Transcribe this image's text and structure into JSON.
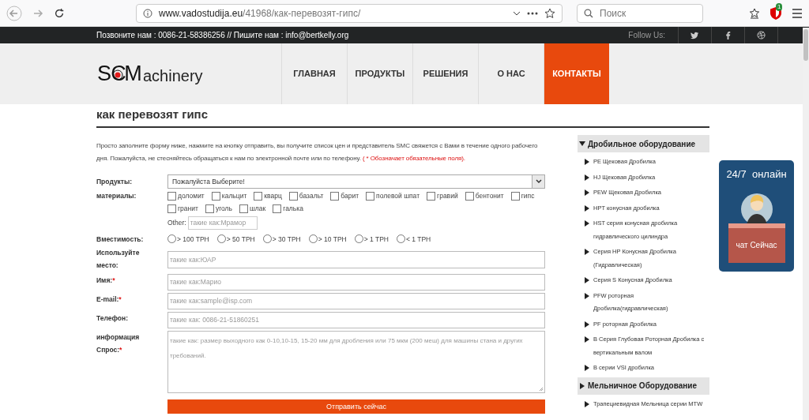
{
  "browser": {
    "url_host": "www.vadostudija.eu",
    "url_path": "/41968/как-перевозят-гипс/",
    "search_placeholder": "Поиск",
    "badge": "1"
  },
  "topbar": {
    "contact": "Позвоните нам : 0086-21-58386256 // Пишите нам : info@bertkelly.org",
    "follow": "Follow Us:"
  },
  "logo": {
    "left": "SC",
    "right": "M",
    "suffix": "achinery"
  },
  "nav": [
    {
      "label": "ГЛАВНАЯ",
      "selected": false
    },
    {
      "label": "ПРОДУКТЫ",
      "selected": false
    },
    {
      "label": "РЕШЕНИЯ",
      "selected": false
    },
    {
      "label": "О НАС",
      "selected": false
    },
    {
      "label": "КОНТАКТЫ",
      "selected": true
    }
  ],
  "page_title": "как перевозят гипс",
  "intro": "Просто заполните форму ниже, нажмите на кнопку отправить, вы получите список цен и представитель SMC свяжется с Вами в течение одного рабочего дня. Пожалуйста, не стесняйтесь обращаться к нам по электронной почте или по телефону.",
  "intro_required": "( * Обозначает обязательные поля).",
  "form": {
    "products_label": "Продукты:",
    "products_value": "Пожалуйста Выберите!",
    "materials_label": "материалы:",
    "materials": [
      {
        "label": "доломит",
        "checked": false
      },
      {
        "label": "кальцит",
        "checked": false
      },
      {
        "label": "кварц",
        "checked": false
      },
      {
        "label": "базальт",
        "checked": false
      },
      {
        "label": "барит",
        "checked": false
      },
      {
        "label": "полевой шпат",
        "checked": false
      },
      {
        "label": "гравий",
        "checked": false
      },
      {
        "label": "бентонит",
        "checked": false
      },
      {
        "label": "гипс",
        "checked": false
      },
      {
        "label": "гранит",
        "checked": false
      },
      {
        "label": "уголь",
        "checked": false
      },
      {
        "label": "шлак",
        "checked": false
      },
      {
        "label": "галька",
        "checked": false
      }
    ],
    "other_label": "Other:",
    "other_placeholder": "такие как:Мрамор",
    "capacity_label": "Вместимость:",
    "capacity": [
      {
        "label": "> 100 TPH",
        "selected": false
      },
      {
        "label": "> 50 TPH",
        "selected": false
      },
      {
        "label": "> 30 TPH",
        "selected": false
      },
      {
        "label": "> 10 TPH",
        "selected": false
      },
      {
        "label": "> 1 TPH",
        "selected": false
      },
      {
        "label": "< 1 TPH",
        "selected": false
      }
    ],
    "fields": [
      {
        "label": "Используйте место:",
        "required": false,
        "placeholder": "такие как:ЮАР",
        "kind": "input"
      },
      {
        "label": "Имя:",
        "required": true,
        "placeholder": "такие как:Марио",
        "kind": "input"
      },
      {
        "label": "E-mail:",
        "required": true,
        "placeholder": "такие как:sample@isp.com",
        "kind": "input"
      },
      {
        "label": "Телефон:",
        "required": false,
        "placeholder": "такие как: 0086-21-51860251",
        "kind": "input"
      },
      {
        "label": "информация Спрос:",
        "required": true,
        "placeholder": "такие как: размер выходного как 0-10,10-15, 15-20 мм для дробления или 75 мкм (200 меш) для машины стана и других требований.",
        "kind": "textarea"
      }
    ],
    "required_mark": "*",
    "submit": "Отправить сейчас"
  },
  "sidebar": [
    {
      "title": "Дробильное оборудование",
      "expanded": true,
      "children": [
        {
          "label": "PE Щековая Дробилка"
        },
        {
          "label": "HJ Щековая Дробилка"
        },
        {
          "label": "PEW Щековая Дробилка"
        },
        {
          "label": "HPT конусная дробилка"
        },
        {
          "label": "HST серия конусная дробилка гидравлического цилиндра"
        },
        {
          "label": "Серия HP Конусная Дробилка (Гидравлическая)"
        },
        {
          "label": "Серия S Конусная Дробилка"
        },
        {
          "label": "PFW роторная Дробилка(гидравлическая)"
        },
        {
          "label": "PF роторная Дробилка"
        },
        {
          "label": "B Серия Глубовая Роторная Дробилка с вертикальным валом"
        },
        {
          "label": "B серии VSI дробилка"
        }
      ]
    },
    {
      "title": "Мельничное Оборудование",
      "expanded": false,
      "children": [
        {
          "label": "Трапециевидная Мельница серии MTW"
        }
      ]
    }
  ],
  "chat": {
    "title": "24/7  онлайн",
    "button": "чат Сейчас"
  }
}
